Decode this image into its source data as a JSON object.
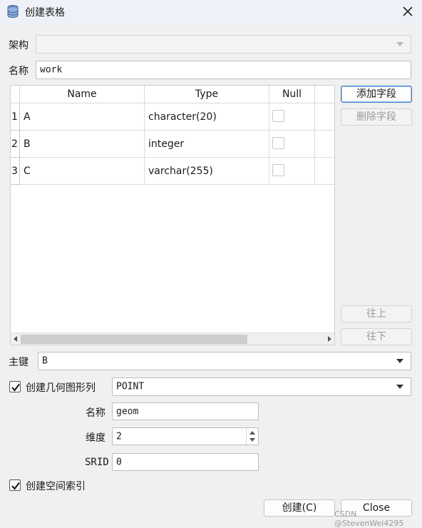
{
  "window": {
    "title": "创建表格",
    "icon": "database-icon"
  },
  "schema": {
    "label": "架构",
    "value": ""
  },
  "name": {
    "label": "名称",
    "value": "work"
  },
  "table": {
    "columns": [
      "Name",
      "Type",
      "Null"
    ],
    "rows": [
      {
        "num": "1",
        "name": "A",
        "type": "character(20)",
        "null": false
      },
      {
        "num": "2",
        "name": "B",
        "type": "integer",
        "null": false
      },
      {
        "num": "3",
        "name": "C",
        "type": "varchar(255)",
        "null": false
      }
    ]
  },
  "side_buttons": {
    "add": "添加字段",
    "delete": "删除字段",
    "up": "往上",
    "down": "往下"
  },
  "primary_key": {
    "label": "主键",
    "value": "B"
  },
  "geometry": {
    "checkbox_label": "创建几何图形列",
    "checked": true,
    "type_value": "POINT",
    "name_label": "名称",
    "name_value": "geom",
    "dim_label": "维度",
    "dim_value": "2",
    "srid_label": "SRID",
    "srid_value": "0"
  },
  "spatial_index": {
    "label": "创建空间索引",
    "checked": true
  },
  "footer": {
    "create": "创建(C)",
    "close": "Close"
  },
  "watermark": "CSDN @StevenWei4295"
}
